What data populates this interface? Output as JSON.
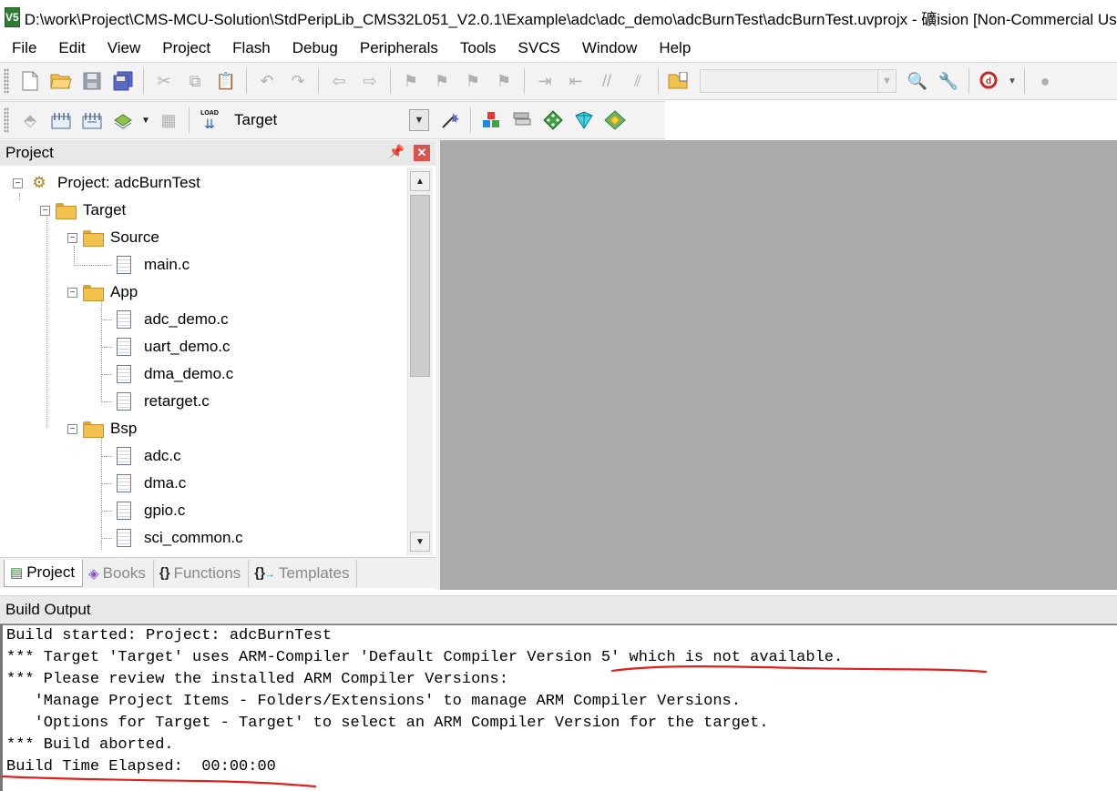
{
  "window": {
    "title": "D:\\work\\Project\\CMS-MCU-Solution\\StdPeripLib_CMS32L051_V2.0.1\\Example\\adc\\adc_demo\\adcBurnTest\\adcBurnTest.uvprojx - 礦ision  [Non-Commercial Use License]",
    "icon_label": "V5"
  },
  "menu": [
    "File",
    "Edit",
    "View",
    "Project",
    "Flash",
    "Debug",
    "Peripherals",
    "Tools",
    "SVCS",
    "Window",
    "Help"
  ],
  "toolbar2": {
    "load_label": "LOAD",
    "target_value": "Target"
  },
  "project_panel": {
    "title": "Project",
    "tree": {
      "project_label": "Project: adcBurnTest",
      "target_label": "Target",
      "groups": [
        {
          "name": "Source",
          "files": [
            "main.c"
          ]
        },
        {
          "name": "App",
          "files": [
            "adc_demo.c",
            "uart_demo.c",
            "dma_demo.c",
            "retarget.c"
          ]
        },
        {
          "name": "Bsp",
          "files": [
            "adc.c",
            "dma.c",
            "gpio.c",
            "sci_common.c"
          ]
        }
      ]
    },
    "tabs": [
      {
        "label": "Project",
        "icon": "project-tab-icon",
        "active": true
      },
      {
        "label": "Books",
        "icon": "books-icon",
        "active": false
      },
      {
        "label": "Functions",
        "icon": "braces-icon",
        "active": false
      },
      {
        "label": "Templates",
        "icon": "templates-icon",
        "active": false
      }
    ]
  },
  "build_output": {
    "title": "Build Output",
    "lines": [
      "Build started: Project: adcBurnTest",
      "*** Target 'Target' uses ARM-Compiler 'Default Compiler Version 5' which is not available.",
      "*** Please review the installed ARM Compiler Versions:",
      "   'Manage Project Items - Folders/Extensions' to manage ARM Compiler Versions.",
      "   'Options for Target - Target' to select an ARM Compiler Version for the target.",
      "*** Build aborted.",
      "Build Time Elapsed:  00:00:00"
    ],
    "annotation_color": "#e0201c"
  }
}
